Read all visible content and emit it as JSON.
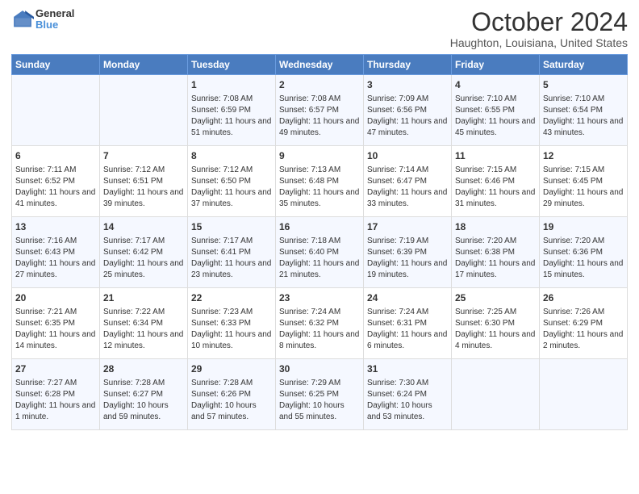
{
  "header": {
    "logo_line1": "General",
    "logo_line2": "Blue",
    "title": "October 2024",
    "subtitle": "Haughton, Louisiana, United States"
  },
  "days_of_week": [
    "Sunday",
    "Monday",
    "Tuesday",
    "Wednesday",
    "Thursday",
    "Friday",
    "Saturday"
  ],
  "weeks": [
    [
      {
        "day": "",
        "sunrise": "",
        "sunset": "",
        "daylight": ""
      },
      {
        "day": "",
        "sunrise": "",
        "sunset": "",
        "daylight": ""
      },
      {
        "day": "1",
        "sunrise": "Sunrise: 7:08 AM",
        "sunset": "Sunset: 6:59 PM",
        "daylight": "Daylight: 11 hours and 51 minutes."
      },
      {
        "day": "2",
        "sunrise": "Sunrise: 7:08 AM",
        "sunset": "Sunset: 6:57 PM",
        "daylight": "Daylight: 11 hours and 49 minutes."
      },
      {
        "day": "3",
        "sunrise": "Sunrise: 7:09 AM",
        "sunset": "Sunset: 6:56 PM",
        "daylight": "Daylight: 11 hours and 47 minutes."
      },
      {
        "day": "4",
        "sunrise": "Sunrise: 7:10 AM",
        "sunset": "Sunset: 6:55 PM",
        "daylight": "Daylight: 11 hours and 45 minutes."
      },
      {
        "day": "5",
        "sunrise": "Sunrise: 7:10 AM",
        "sunset": "Sunset: 6:54 PM",
        "daylight": "Daylight: 11 hours and 43 minutes."
      }
    ],
    [
      {
        "day": "6",
        "sunrise": "Sunrise: 7:11 AM",
        "sunset": "Sunset: 6:52 PM",
        "daylight": "Daylight: 11 hours and 41 minutes."
      },
      {
        "day": "7",
        "sunrise": "Sunrise: 7:12 AM",
        "sunset": "Sunset: 6:51 PM",
        "daylight": "Daylight: 11 hours and 39 minutes."
      },
      {
        "day": "8",
        "sunrise": "Sunrise: 7:12 AM",
        "sunset": "Sunset: 6:50 PM",
        "daylight": "Daylight: 11 hours and 37 minutes."
      },
      {
        "day": "9",
        "sunrise": "Sunrise: 7:13 AM",
        "sunset": "Sunset: 6:48 PM",
        "daylight": "Daylight: 11 hours and 35 minutes."
      },
      {
        "day": "10",
        "sunrise": "Sunrise: 7:14 AM",
        "sunset": "Sunset: 6:47 PM",
        "daylight": "Daylight: 11 hours and 33 minutes."
      },
      {
        "day": "11",
        "sunrise": "Sunrise: 7:15 AM",
        "sunset": "Sunset: 6:46 PM",
        "daylight": "Daylight: 11 hours and 31 minutes."
      },
      {
        "day": "12",
        "sunrise": "Sunrise: 7:15 AM",
        "sunset": "Sunset: 6:45 PM",
        "daylight": "Daylight: 11 hours and 29 minutes."
      }
    ],
    [
      {
        "day": "13",
        "sunrise": "Sunrise: 7:16 AM",
        "sunset": "Sunset: 6:43 PM",
        "daylight": "Daylight: 11 hours and 27 minutes."
      },
      {
        "day": "14",
        "sunrise": "Sunrise: 7:17 AM",
        "sunset": "Sunset: 6:42 PM",
        "daylight": "Daylight: 11 hours and 25 minutes."
      },
      {
        "day": "15",
        "sunrise": "Sunrise: 7:17 AM",
        "sunset": "Sunset: 6:41 PM",
        "daylight": "Daylight: 11 hours and 23 minutes."
      },
      {
        "day": "16",
        "sunrise": "Sunrise: 7:18 AM",
        "sunset": "Sunset: 6:40 PM",
        "daylight": "Daylight: 11 hours and 21 minutes."
      },
      {
        "day": "17",
        "sunrise": "Sunrise: 7:19 AM",
        "sunset": "Sunset: 6:39 PM",
        "daylight": "Daylight: 11 hours and 19 minutes."
      },
      {
        "day": "18",
        "sunrise": "Sunrise: 7:20 AM",
        "sunset": "Sunset: 6:38 PM",
        "daylight": "Daylight: 11 hours and 17 minutes."
      },
      {
        "day": "19",
        "sunrise": "Sunrise: 7:20 AM",
        "sunset": "Sunset: 6:36 PM",
        "daylight": "Daylight: 11 hours and 15 minutes."
      }
    ],
    [
      {
        "day": "20",
        "sunrise": "Sunrise: 7:21 AM",
        "sunset": "Sunset: 6:35 PM",
        "daylight": "Daylight: 11 hours and 14 minutes."
      },
      {
        "day": "21",
        "sunrise": "Sunrise: 7:22 AM",
        "sunset": "Sunset: 6:34 PM",
        "daylight": "Daylight: 11 hours and 12 minutes."
      },
      {
        "day": "22",
        "sunrise": "Sunrise: 7:23 AM",
        "sunset": "Sunset: 6:33 PM",
        "daylight": "Daylight: 11 hours and 10 minutes."
      },
      {
        "day": "23",
        "sunrise": "Sunrise: 7:24 AM",
        "sunset": "Sunset: 6:32 PM",
        "daylight": "Daylight: 11 hours and 8 minutes."
      },
      {
        "day": "24",
        "sunrise": "Sunrise: 7:24 AM",
        "sunset": "Sunset: 6:31 PM",
        "daylight": "Daylight: 11 hours and 6 minutes."
      },
      {
        "day": "25",
        "sunrise": "Sunrise: 7:25 AM",
        "sunset": "Sunset: 6:30 PM",
        "daylight": "Daylight: 11 hours and 4 minutes."
      },
      {
        "day": "26",
        "sunrise": "Sunrise: 7:26 AM",
        "sunset": "Sunset: 6:29 PM",
        "daylight": "Daylight: 11 hours and 2 minutes."
      }
    ],
    [
      {
        "day": "27",
        "sunrise": "Sunrise: 7:27 AM",
        "sunset": "Sunset: 6:28 PM",
        "daylight": "Daylight: 11 hours and 1 minute."
      },
      {
        "day": "28",
        "sunrise": "Sunrise: 7:28 AM",
        "sunset": "Sunset: 6:27 PM",
        "daylight": "Daylight: 10 hours and 59 minutes."
      },
      {
        "day": "29",
        "sunrise": "Sunrise: 7:28 AM",
        "sunset": "Sunset: 6:26 PM",
        "daylight": "Daylight: 10 hours and 57 minutes."
      },
      {
        "day": "30",
        "sunrise": "Sunrise: 7:29 AM",
        "sunset": "Sunset: 6:25 PM",
        "daylight": "Daylight: 10 hours and 55 minutes."
      },
      {
        "day": "31",
        "sunrise": "Sunrise: 7:30 AM",
        "sunset": "Sunset: 6:24 PM",
        "daylight": "Daylight: 10 hours and 53 minutes."
      },
      {
        "day": "",
        "sunrise": "",
        "sunset": "",
        "daylight": ""
      },
      {
        "day": "",
        "sunrise": "",
        "sunset": "",
        "daylight": ""
      }
    ]
  ]
}
